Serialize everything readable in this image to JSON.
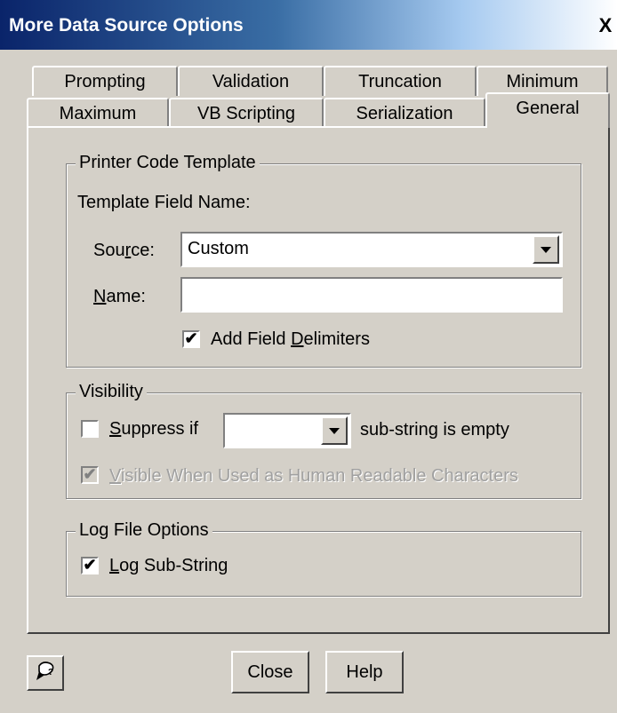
{
  "window": {
    "title": "More Data Source Options",
    "close_glyph": "X"
  },
  "tabs_row1": [
    "Prompting",
    "Validation",
    "Truncation",
    "Minimum"
  ],
  "tabs_row2": [
    "Maximum",
    "VB Scripting",
    "Serialization",
    "General"
  ],
  "active_tab": "General",
  "printer_group": {
    "legend": "Printer Code Template",
    "template_field_label": "Template Field Name:",
    "source_label_pre": "Sou",
    "source_label_acc": "r",
    "source_label_post": "ce:",
    "source_value": "Custom",
    "name_label_acc": "N",
    "name_label_post": "ame:",
    "name_value": "",
    "add_delim_pre": "Add Field ",
    "add_delim_acc": "D",
    "add_delim_post": "elimiters",
    "add_delim_checked": true
  },
  "visibility_group": {
    "legend": "Visibility",
    "suppress_acc": "S",
    "suppress_post": "uppress if",
    "suppress_checked": false,
    "suppress_select_value": "",
    "suffix": "sub-string is empty",
    "visible_acc": "V",
    "visible_post": "isible When Used as Human Readable Characters",
    "visible_checked": true
  },
  "log_group": {
    "legend": "Log File Options",
    "log_acc": "L",
    "log_post": "og Sub-String",
    "log_checked": true
  },
  "buttons": {
    "close": "Close",
    "help": "Help"
  },
  "icons": {
    "help_context": "help-context-icon"
  }
}
